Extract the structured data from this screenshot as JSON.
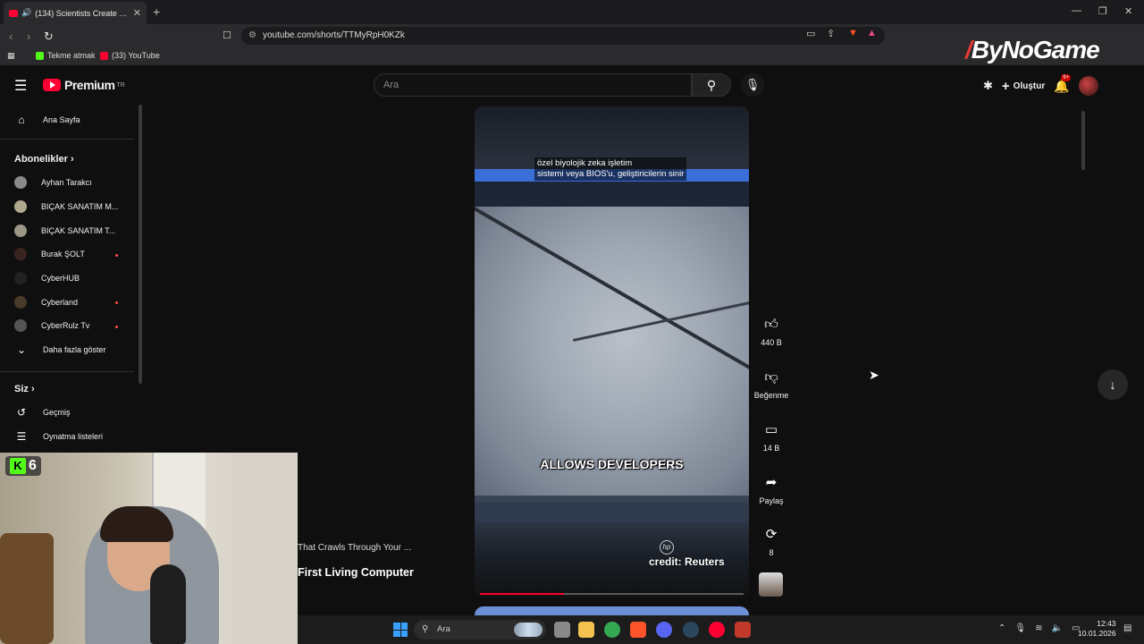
{
  "browser": {
    "tab_title": "(134) Scientists Create World",
    "tab_close": "✕",
    "new_tab": "+",
    "url": "youtube.com/shorts/TTMyRpH0KZk",
    "bookmarks": [
      {
        "label": "Tekme atmak",
        "color": "#53fc18"
      },
      {
        "label": "(33) YouTube",
        "color": "#ff0033"
      }
    ],
    "window_controls": [
      "—",
      "❐",
      "✕"
    ]
  },
  "overlay_logo": {
    "text": "ByNoGame"
  },
  "youtube": {
    "logo_text": "Premium",
    "logo_sup": "TR",
    "search_placeholder": "Ara",
    "create_label": "Oluştur",
    "notif_count": "9+",
    "sidebar": {
      "home": "Ana Sayfa",
      "subscriptions_heading": "Abonelikler",
      "subscriptions": [
        {
          "name": "Ayhan Tarakcı",
          "color": "#8a8a8a",
          "live": false
        },
        {
          "name": "BIÇAK SANATIM M...",
          "color": "#b0a890",
          "live": false
        },
        {
          "name": "BIÇAK SANATIM T...",
          "color": "#9c9686",
          "live": false
        },
        {
          "name": "Burak ŞOLT",
          "color": "#3a2420",
          "live": true
        },
        {
          "name": "CyberHUB",
          "color": "#222222",
          "live": false
        },
        {
          "name": "Cyberland",
          "color": "#4a3a2a",
          "live": true
        },
        {
          "name": "CyberRulz Tv",
          "color": "#555555",
          "live": true
        }
      ],
      "show_more": "Daha fazla göster",
      "you_heading": "Siz",
      "history": "Geçmiş",
      "playlists": "Oynatma listeleri"
    },
    "short": {
      "caption_tr_line1": "özel biyolojik zeka işletim",
      "caption_tr_line2": "sistemi veya BIOS'u, geliştiricilerin sinir",
      "caption_en": "ALLOWS DEVELOPERS",
      "hp_logo": "hp",
      "credit": "credit: Reuters",
      "progress": 0.32
    },
    "actions": {
      "likes": "440 B",
      "dislike": "Beğenme",
      "comments": "14 B",
      "share": "Paylaş",
      "remix": "8"
    },
    "title_fragment_1": "That Crawls Through Your ...",
    "title_fragment_2": "First Living Computer"
  },
  "webcam": {
    "kick_count": "6"
  },
  "taskbar": {
    "search_placeholder": "Ara",
    "time": "12:43",
    "date": "10.01.2026",
    "apps": [
      {
        "name": "file-explorer",
        "color": "#f2c14e"
      },
      {
        "name": "chrome",
        "color": "#34a853"
      },
      {
        "name": "brave",
        "color": "#fb542b"
      },
      {
        "name": "discord",
        "color": "#5865f2"
      },
      {
        "name": "steam",
        "color": "#2a475e"
      },
      {
        "name": "youtube-music",
        "color": "#ff0033"
      },
      {
        "name": "app",
        "color": "#c0392b"
      }
    ]
  }
}
